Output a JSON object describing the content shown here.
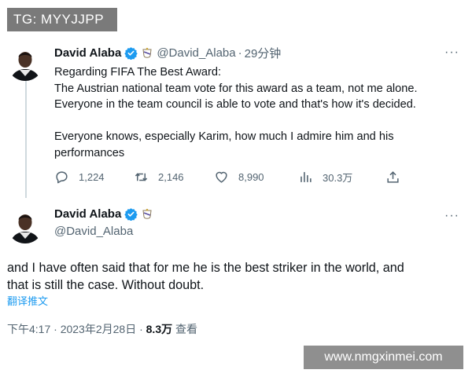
{
  "overlay": {
    "tg_label": "TG: MYYJJPP",
    "watermark": "www.nmgxinmei.com"
  },
  "parent_tweet": {
    "display_name": "David Alaba",
    "handle": "@David_Alaba",
    "separator": "·",
    "time_ago": "29分钟",
    "more_label": "···",
    "lines": [
      "Regarding FIFA The Best Award:",
      "The Austrian national team vote for this award as a team, not me alone.",
      "Everyone in the team council is able to vote and that's how it's decided.",
      "",
      "Everyone knows, especially Karim, how much I admire him and his",
      "performances"
    ],
    "replies": "1,224",
    "retweets": "2,146",
    "likes": "8,990",
    "views": "30.3万"
  },
  "main_tweet": {
    "display_name": "David Alaba",
    "handle": "@David_Alaba",
    "more_label": "···",
    "text_line1": "and I have often said that for me he is the best striker in the world, and",
    "text_line2": "that is still the case. Without doubt.",
    "translate_label": "翻译推文",
    "timestamp": "下午4:17 · 2023年2月28日 ·",
    "views_count": "8.3万",
    "views_label": "查看"
  },
  "colors": {
    "verified_blue": "#1d9bf0",
    "text_primary": "#0f1419",
    "text_secondary": "#536471",
    "link_blue": "#1d9bf0"
  },
  "icons": {
    "reply": "reply-icon",
    "retweet": "retweet-icon",
    "like": "heart-icon",
    "views": "bar-chart-icon",
    "share": "share-icon",
    "verified": "verified-badge-icon",
    "club": "club-crest-icon"
  }
}
